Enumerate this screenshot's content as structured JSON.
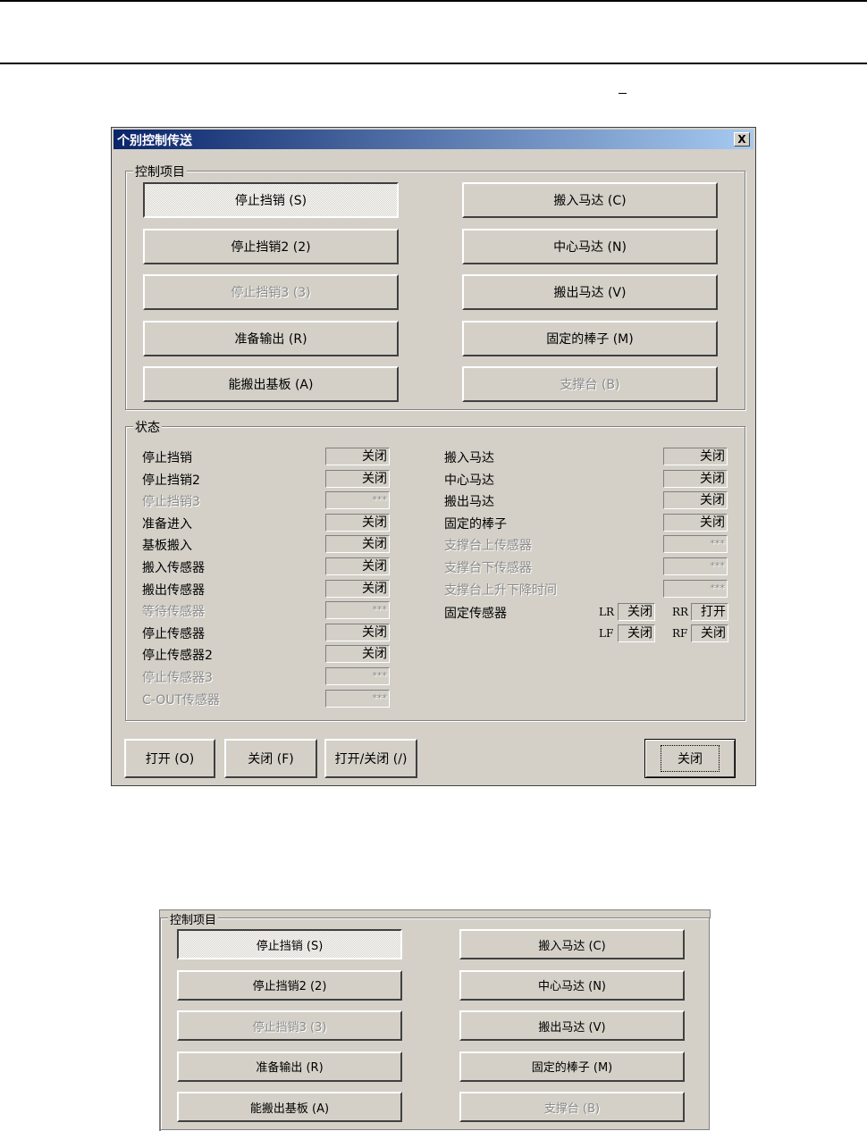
{
  "dialog": {
    "title": "个别控制传送",
    "close_glyph": "X",
    "control_group": {
      "legend": "控制项目",
      "buttons_left": [
        {
          "label": "停止挡销 (S)",
          "state": "pressed"
        },
        {
          "label": "停止挡销2 (2)",
          "state": "normal"
        },
        {
          "label": "停止挡销3 (3)",
          "state": "disabled"
        },
        {
          "label": "准备输出 (R)",
          "state": "normal"
        },
        {
          "label": "能搬出基板 (A)",
          "state": "normal"
        }
      ],
      "buttons_right": [
        {
          "label": "搬入马达 (C)",
          "state": "normal"
        },
        {
          "label": "中心马达 (N)",
          "state": "normal"
        },
        {
          "label": "搬出马达 (V)",
          "state": "normal"
        },
        {
          "label": "固定的棒子 (M)",
          "state": "normal"
        },
        {
          "label": "支撑台 (B)",
          "state": "disabled"
        }
      ]
    },
    "status_group": {
      "legend": "状态",
      "left": [
        {
          "label": "停止挡销",
          "value": "关闭",
          "enabled": true
        },
        {
          "label": "停止挡销2",
          "value": "关闭",
          "enabled": true
        },
        {
          "label": "停止挡销3",
          "value": "***",
          "enabled": false
        },
        {
          "label": "准备进入",
          "value": "关闭",
          "enabled": true
        },
        {
          "label": "基板搬入",
          "value": "关闭",
          "enabled": true
        },
        {
          "label": "搬入传感器",
          "value": "关闭",
          "enabled": true
        },
        {
          "label": "搬出传感器",
          "value": "关闭",
          "enabled": true
        },
        {
          "label": "等待传感器",
          "value": "***",
          "enabled": false
        },
        {
          "label": "停止传感器",
          "value": "关闭",
          "enabled": true
        },
        {
          "label": "停止传感器2",
          "value": "关闭",
          "enabled": true
        },
        {
          "label": "停止传感器3",
          "value": "***",
          "enabled": false
        },
        {
          "label": "C-OUT传感器",
          "value": "***",
          "enabled": false
        }
      ],
      "right": [
        {
          "label": "搬入马达",
          "value": "关闭",
          "enabled": true
        },
        {
          "label": "中心马达",
          "value": "关闭",
          "enabled": true
        },
        {
          "label": "搬出马达",
          "value": "关闭",
          "enabled": true
        },
        {
          "label": "固定的棒子",
          "value": "关闭",
          "enabled": true
        },
        {
          "label": "支撑台上传感器",
          "value": "***",
          "enabled": false
        },
        {
          "label": "支撑台下传感器",
          "value": "***",
          "enabled": false
        },
        {
          "label": "支撑台上升下降时间",
          "value": "***",
          "enabled": false
        }
      ],
      "fixed_sensor": {
        "label": "固定传感器",
        "lr_label": "LR",
        "lr_value": "关闭",
        "rr_label": "RR",
        "rr_value": "打开",
        "lf_label": "LF",
        "lf_value": "关闭",
        "rf_label": "RF",
        "rf_value": "关闭"
      }
    },
    "bottom_buttons": {
      "open": "打开 (O)",
      "close_f": "关闭 (F)",
      "toggle": "打开/关闭 (/)",
      "close": "关闭"
    }
  },
  "panel2": {
    "legend": "控制项目",
    "buttons_left": [
      {
        "label": "停止挡销 (S)",
        "state": "pressed"
      },
      {
        "label": "停止挡销2 (2)",
        "state": "normal"
      },
      {
        "label": "停止挡销3 (3)",
        "state": "disabled"
      },
      {
        "label": "准备输出 (R)",
        "state": "normal"
      },
      {
        "label": "能搬出基板 (A)",
        "state": "normal"
      }
    ],
    "buttons_right": [
      {
        "label": "搬入马达 (C)",
        "state": "normal"
      },
      {
        "label": "中心马达 (N)",
        "state": "normal"
      },
      {
        "label": "搬出马达 (V)",
        "state": "normal"
      },
      {
        "label": "固定的棒子 (M)",
        "state": "normal"
      },
      {
        "label": "支撑台 (B)",
        "state": "disabled"
      }
    ]
  }
}
